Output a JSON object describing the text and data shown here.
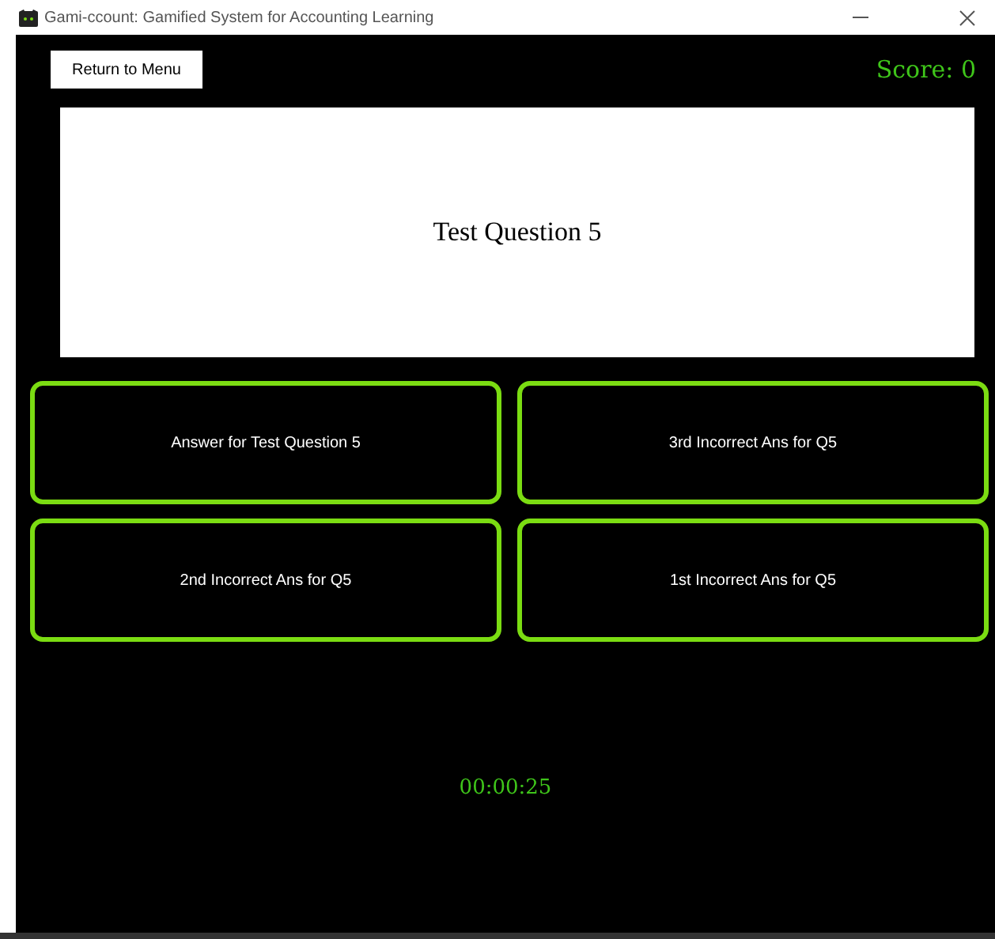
{
  "window": {
    "title": "Gami-ccount: Gamified System for Accounting Learning"
  },
  "return_button": "Return to Menu",
  "score": "Score: 0",
  "question": "Test Question 5",
  "answers": [
    "Answer for Test Question 5",
    "3rd Incorrect Ans for Q5",
    "2nd Incorrect Ans for Q5",
    "1st Incorrect Ans for Q5"
  ],
  "timer": "00:00:25"
}
